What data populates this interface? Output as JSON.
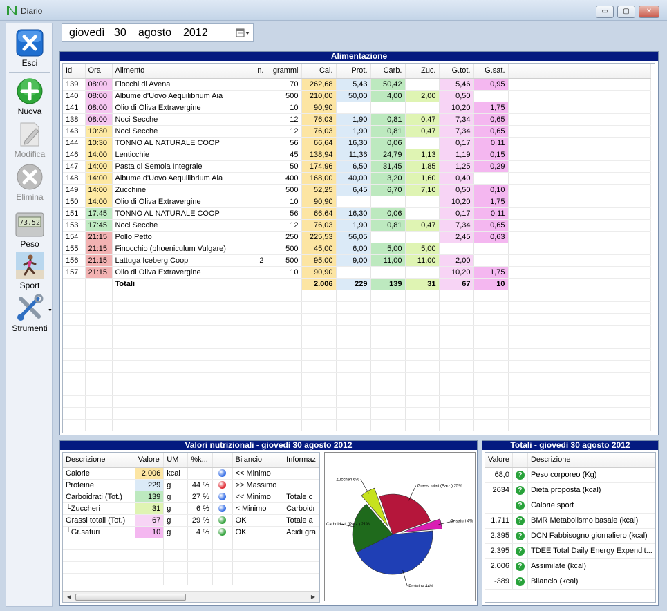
{
  "window": {
    "title": "Diario",
    "minimize_glyph": "▭",
    "maximize_glyph": "▢",
    "close_glyph": "✕"
  },
  "sidebar": {
    "items": [
      {
        "label": "Esci",
        "icon": "exit-x-icon",
        "enabled": true
      },
      {
        "label": "Nuova",
        "icon": "plus-icon",
        "enabled": true
      },
      {
        "label": "Modifica",
        "icon": "edit-icon",
        "enabled": false
      },
      {
        "label": "Elimina",
        "icon": "delete-icon",
        "enabled": false
      },
      {
        "label": "Peso",
        "icon": "scale-icon",
        "enabled": true,
        "display": "73.52"
      },
      {
        "label": "Sport",
        "icon": "runner-icon",
        "enabled": true
      },
      {
        "label": "Strumenti",
        "icon": "tools-icon",
        "enabled": true
      }
    ]
  },
  "date": {
    "weekday": "giovedì",
    "day": "30",
    "month": "agosto",
    "year": "2012"
  },
  "food_panel": {
    "title": "Alimentazione",
    "columns": [
      "Id",
      "Ora",
      "Alimento",
      "n.",
      "grammi",
      "Cal.",
      "Prot.",
      "Carb.",
      "Zuc.",
      "G.tot.",
      "G.sat."
    ],
    "rows": [
      {
        "id": "139",
        "ora": "08:00",
        "ora_color": "pink",
        "alimento": "Fiocchi di Avena",
        "n": "",
        "grammi": "70",
        "cal": "262,68",
        "prot": "5,43",
        "carb": "50,42",
        "zuc": "",
        "gtot": "5,46",
        "gsat": "0,95"
      },
      {
        "id": "140",
        "ora": "08:00",
        "ora_color": "pink",
        "alimento": "Albume d'Uovo Aequilibrium Aia",
        "n": "",
        "grammi": "500",
        "cal": "210,00",
        "prot": "50,00",
        "carb": "4,00",
        "zuc": "2,00",
        "gtot": "0,50",
        "gsat": ""
      },
      {
        "id": "141",
        "ora": "08:00",
        "ora_color": "pink",
        "alimento": "Olio di Oliva Extravergine",
        "n": "",
        "grammi": "10",
        "cal": "90,90",
        "prot": "",
        "carb": "",
        "zuc": "",
        "gtot": "10,20",
        "gsat": "1,75"
      },
      {
        "id": "138",
        "ora": "08:00",
        "ora_color": "pink",
        "alimento": "Noci Secche",
        "n": "",
        "grammi": "12",
        "cal": "76,03",
        "prot": "1,90",
        "carb": "0,81",
        "zuc": "0,47",
        "gtot": "7,34",
        "gsat": "0,65"
      },
      {
        "id": "143",
        "ora": "10:30",
        "ora_color": "yellow",
        "alimento": "Noci Secche",
        "n": "",
        "grammi": "12",
        "cal": "76,03",
        "prot": "1,90",
        "carb": "0,81",
        "zuc": "0,47",
        "gtot": "7,34",
        "gsat": "0,65"
      },
      {
        "id": "144",
        "ora": "10:30",
        "ora_color": "yellow",
        "alimento": "TONNO AL NATURALE COOP",
        "n": "",
        "grammi": "56",
        "cal": "66,64",
        "prot": "16,30",
        "carb": "0,06",
        "zuc": "",
        "gtot": "0,17",
        "gsat": "0,11"
      },
      {
        "id": "146",
        "ora": "14:00",
        "ora_color": "yellow",
        "alimento": "Lenticchie",
        "n": "",
        "grammi": "45",
        "cal": "138,94",
        "prot": "11,36",
        "carb": "24,79",
        "zuc": "1,13",
        "gtot": "1,19",
        "gsat": "0,15"
      },
      {
        "id": "147",
        "ora": "14:00",
        "ora_color": "yellow",
        "alimento": "Pasta di Semola Integrale",
        "n": "",
        "grammi": "50",
        "cal": "174,96",
        "prot": "6,50",
        "carb": "31,45",
        "zuc": "1,85",
        "gtot": "1,25",
        "gsat": "0,29"
      },
      {
        "id": "148",
        "ora": "14:00",
        "ora_color": "yellow",
        "alimento": "Albume d'Uovo Aequilibrium Aia",
        "n": "",
        "grammi": "400",
        "cal": "168,00",
        "prot": "40,00",
        "carb": "3,20",
        "zuc": "1,60",
        "gtot": "0,40",
        "gsat": ""
      },
      {
        "id": "149",
        "ora": "14:00",
        "ora_color": "yellow",
        "alimento": "Zucchine",
        "n": "",
        "grammi": "500",
        "cal": "52,25",
        "prot": "6,45",
        "carb": "6,70",
        "zuc": "7,10",
        "gtot": "0,50",
        "gsat": "0,10"
      },
      {
        "id": "150",
        "ora": "14:00",
        "ora_color": "yellow",
        "alimento": "Olio di Oliva Extravergine",
        "n": "",
        "grammi": "10",
        "cal": "90,90",
        "prot": "",
        "carb": "",
        "zuc": "",
        "gtot": "10,20",
        "gsat": "1,75"
      },
      {
        "id": "151",
        "ora": "17:45",
        "ora_color": "green",
        "alimento": "TONNO AL NATURALE COOP",
        "n": "",
        "grammi": "56",
        "cal": "66,64",
        "prot": "16,30",
        "carb": "0,06",
        "zuc": "",
        "gtot": "0,17",
        "gsat": "0,11"
      },
      {
        "id": "153",
        "ora": "17:45",
        "ora_color": "green",
        "alimento": "Noci Secche",
        "n": "",
        "grammi": "12",
        "cal": "76,03",
        "prot": "1,90",
        "carb": "0,81",
        "zuc": "0,47",
        "gtot": "7,34",
        "gsat": "0,65"
      },
      {
        "id": "154",
        "ora": "21:15",
        "ora_color": "red",
        "alimento": "Pollo Petto",
        "n": "",
        "grammi": "250",
        "cal": "225,53",
        "prot": "56,05",
        "carb": "",
        "zuc": "",
        "gtot": "2,45",
        "gsat": "0,63"
      },
      {
        "id": "155",
        "ora": "21:15",
        "ora_color": "red",
        "alimento": "Finocchio (phoeniculum Vulgare)",
        "n": "",
        "grammi": "500",
        "cal": "45,00",
        "prot": "6,00",
        "carb": "5,00",
        "zuc": "5,00",
        "gtot": "",
        "gsat": ""
      },
      {
        "id": "156",
        "ora": "21:15",
        "ora_color": "red",
        "alimento": "Lattuga Iceberg Coop",
        "n": "2",
        "grammi": "500",
        "cal": "95,00",
        "prot": "9,00",
        "carb": "11,00",
        "zuc": "11,00",
        "gtot": "2,00",
        "gsat": ""
      },
      {
        "id": "157",
        "ora": "21:15",
        "ora_color": "red",
        "alimento": "Olio di Oliva Extravergine",
        "n": "",
        "grammi": "10",
        "cal": "90,90",
        "prot": "",
        "carb": "",
        "zuc": "",
        "gtot": "10,20",
        "gsat": "1,75"
      }
    ],
    "totals": {
      "label": "Totali",
      "cal": "2.006",
      "prot": "229",
      "carb": "139",
      "zuc": "31",
      "gtot": "67",
      "gsat": "10"
    }
  },
  "nutri_panel": {
    "title": "Valori nutrizionali - giovedì 30 agosto 2012",
    "columns": [
      "Descrizione",
      "Valore",
      "UM",
      "%k...",
      "",
      "Bilancio",
      "Informaz"
    ],
    "rows": [
      {
        "desc": "Calorie",
        "valore": "2.006",
        "um": "kcal",
        "pk": "",
        "status": "blue",
        "bilancio": "<< Minimo",
        "info": "",
        "vcolor": "#fce5a3"
      },
      {
        "desc": "Proteine",
        "valore": "229",
        "um": "g",
        "pk": "44 %",
        "status": "red",
        "bilancio": ">> Massimo",
        "info": "",
        "vcolor": "#dbeaf7"
      },
      {
        "desc": "Carboidrati (Tot.)",
        "valore": "139",
        "um": "g",
        "pk": "27 %",
        "status": "blue",
        "bilancio": "<< Minimo",
        "info": "Totale c",
        "vcolor": "#bde9bf"
      },
      {
        "desc": "└Zuccheri",
        "valore": "31",
        "um": "g",
        "pk": "6 %",
        "status": "blue",
        "bilancio": "< Minimo",
        "info": "Carboidr",
        "vcolor": "#dff4b3"
      },
      {
        "desc": "Grassi totali (Tot.)",
        "valore": "67",
        "um": "g",
        "pk": "29 %",
        "status": "green",
        "bilancio": "OK",
        "info": "Totale a",
        "vcolor": "#f7d4f5"
      },
      {
        "desc": "└Gr.saturi",
        "valore": "10",
        "um": "g",
        "pk": "4 %",
        "status": "green",
        "bilancio": "OK",
        "info": "Acidi gra",
        "vcolor": "#f4b7f0"
      }
    ],
    "status_colors": {
      "blue": "#3d73e6",
      "red": "#e0323a",
      "green": "#3aa542"
    }
  },
  "chart_data": {
    "type": "pie",
    "title": "",
    "slices": [
      {
        "label": "Proteine 44%",
        "value": 44,
        "color": "#1f3fb5"
      },
      {
        "label": "Carboidrati (Parz.) 21%",
        "value": 21,
        "color": "#1f6a1c"
      },
      {
        "label": "Zuccheri 6%",
        "value": 6,
        "color": "#c6e21e"
      },
      {
        "label": "Grassi totali (Parz.) 25%",
        "value": 25,
        "color": "#b5163b"
      },
      {
        "label": "Gr.saturi 4%",
        "value": 4,
        "color": "#d91fb3"
      }
    ]
  },
  "totals_panel": {
    "title": "Totali - giovedì 30 agosto 2012",
    "columns": [
      "Valore",
      "",
      "Descrizione"
    ],
    "rows": [
      {
        "valore": "68,0",
        "desc": "Peso corporeo (Kg)"
      },
      {
        "valore": "2634",
        "desc": "Dieta proposta (kcal)"
      },
      {
        "valore": "",
        "desc": "Calorie sport"
      },
      {
        "valore": "1.711",
        "desc": "BMR Metabolismo basale (kcal)"
      },
      {
        "valore": "2.395",
        "desc": "DCN Fabbisogno giornaliero (kcal)"
      },
      {
        "valore": "2.395",
        "desc": "TDEE Total Daily Energy Expendit..."
      },
      {
        "valore": "2.006",
        "desc": "Assimilate (kcal)"
      },
      {
        "valore": "-389",
        "desc": "Bilancio (kcal)"
      }
    ],
    "help_glyph": "?"
  }
}
